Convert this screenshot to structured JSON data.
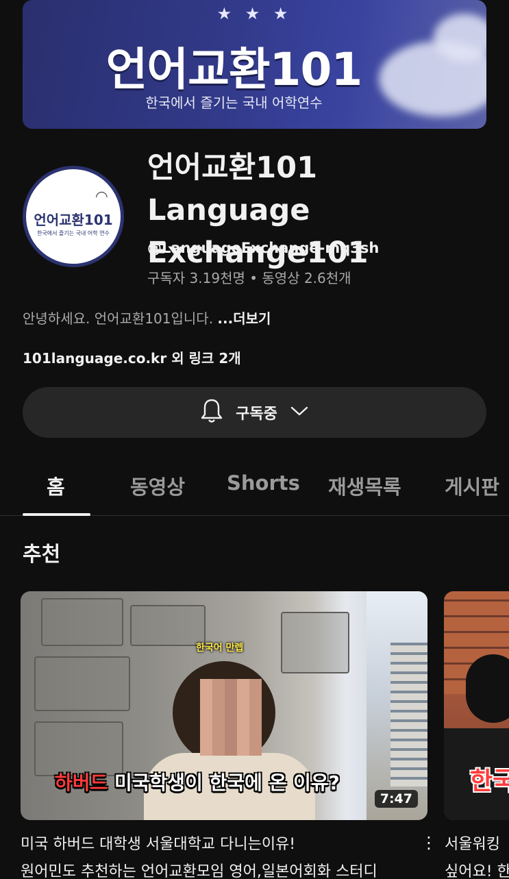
{
  "banner": {
    "title": "언어교환101",
    "subtitle": "한국에서 즐기는 국내 어학연수",
    "stars": "★ ★ ★"
  },
  "channel": {
    "avatar_text": "언어교환101",
    "avatar_sub": "한국에서 즐기는 국내 어학 연수",
    "name": "언어교환101 Language Exchange101",
    "handle": "@LanguageExchange-mq3sh",
    "stats": "구독자 3.19천명 • 동영상 2.6천개",
    "description": "안녕하세요. 언어교환101입니다. ",
    "more_label": "...더보기",
    "links": "101language.co.kr 외 링크 2개"
  },
  "subscribe": {
    "label": "구독중",
    "bell_icon": "bell-icon",
    "chevron_icon": "chevron-down-icon"
  },
  "tabs": [
    {
      "label": "홈",
      "active": true
    },
    {
      "label": "동영상",
      "active": false
    },
    {
      "label": "Shorts",
      "active": false
    },
    {
      "label": "재생목록",
      "active": false
    },
    {
      "label": "게시판",
      "active": false
    }
  ],
  "section": {
    "title": "추천"
  },
  "videos": [
    {
      "thumb_caption_top": "한국어 만렙",
      "thumb_caption_highlight": "하버드",
      "thumb_caption_main": " 미국학생이 한국에 온 이유?",
      "duration": "7:47",
      "title_line1": "미국 하버드 대학생 서울대학교 다니는이유!",
      "title_line2": "원어민도 추천하는 언어교환모임 영어,일본어회화 스터디"
    },
    {
      "thumb_caption": "한국",
      "title_line1": "서울워킹",
      "title_line2": "싶어요! 한"
    }
  ],
  "colors": {
    "background": "#0f0f0f",
    "surface": "#272727",
    "text_primary": "#f1f1f1",
    "text_secondary": "#aaaaaa",
    "banner": "#323a8a"
  }
}
